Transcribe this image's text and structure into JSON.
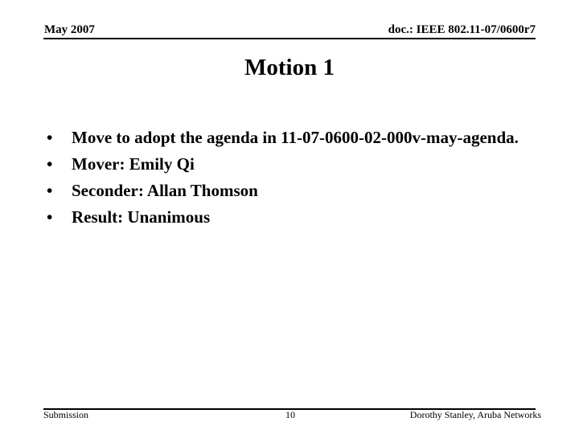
{
  "header": {
    "date": "May 2007",
    "doc_id": "doc.: IEEE 802.11-07/0600r7"
  },
  "slide": {
    "title": "Motion 1",
    "bullets": [
      "Move to adopt the agenda in 11-07-0600-02-000v-may-agenda.",
      "Mover: Emily Qi",
      "Seconder: Allan Thomson",
      "Result: Unanimous"
    ],
    "bullet_glyph": "•"
  },
  "footer": {
    "left": "Submission",
    "page_number": "10",
    "author": "Dorothy Stanley, Aruba Networks"
  }
}
